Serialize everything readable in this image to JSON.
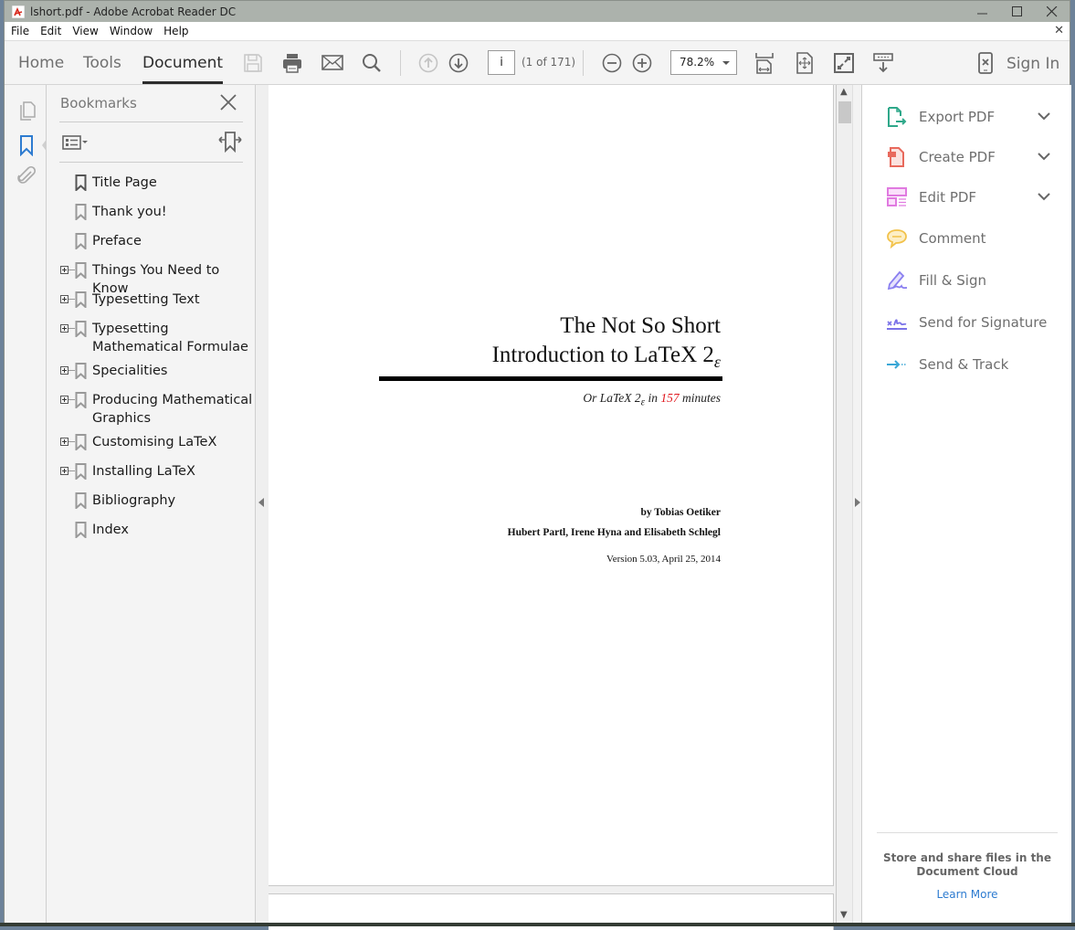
{
  "window": {
    "title": "lshort.pdf - Adobe Acrobat Reader DC",
    "controls": {
      "minimize": "minimize-icon",
      "maximize": "maximize-icon",
      "close": "close-icon"
    }
  },
  "menu": {
    "items": [
      "File",
      "Edit",
      "View",
      "Window",
      "Help"
    ],
    "close_doc_icon": "close-document-icon"
  },
  "toolbar": {
    "tabs": [
      {
        "label": "Home",
        "active": false
      },
      {
        "label": "Tools",
        "active": false
      },
      {
        "label": "Document",
        "active": true
      }
    ],
    "page_input": "i",
    "page_count": "(1 of 171)",
    "zoom_value": "78.2%",
    "sign_in": "Sign In",
    "icons": [
      "save-icon",
      "print-icon",
      "email-icon",
      "search-icon",
      "previous-page-icon",
      "next-page-icon",
      "zoom-out-icon",
      "zoom-in-icon",
      "fit-width-icon",
      "fit-page-icon",
      "full-screen-icon",
      "read-mode-icon",
      "mobile-link-icon"
    ]
  },
  "left_rail": {
    "icons": [
      "page-thumbnails-icon",
      "bookmarks-icon",
      "attachments-icon"
    ],
    "active": "bookmarks-icon",
    "accent": "#2d7bd0"
  },
  "bookmarks": {
    "header": "Bookmarks",
    "items": [
      {
        "label": "Title Page",
        "expandable": false
      },
      {
        "label": "Thank you!",
        "expandable": false
      },
      {
        "label": "Preface",
        "expandable": false
      },
      {
        "label": "Things You Need to Know",
        "expandable": true
      },
      {
        "label": "Typesetting Text",
        "expandable": true
      },
      {
        "label": "Typesetting Mathematical Formulae",
        "expandable": true
      },
      {
        "label": "Specialities",
        "expandable": true
      },
      {
        "label": "Producing Mathematical Graphics",
        "expandable": true
      },
      {
        "label": "Customising LaTeX",
        "expandable": true
      },
      {
        "label": "Installing LaTeX",
        "expandable": true
      },
      {
        "label": "Bibliography",
        "expandable": false
      },
      {
        "label": "Index",
        "expandable": false
      }
    ]
  },
  "document": {
    "title_line1": "The Not So Short",
    "title_line2_prefix": "Introduction to ",
    "latex_logo": "LaTeX",
    "latex_version": "2",
    "epsilon": "ε",
    "subtitle_prefix": "Or ",
    "subtitle_mid": " in ",
    "subtitle_number": "157",
    "subtitle_suffix": " minutes",
    "author_line": "by Tobias Oetiker",
    "coauthors_line": "Hubert Partl, Irene Hyna and Elisabeth Schlegl",
    "version_line": "Version 5.03, April 25, 2014",
    "highlight_color": "#e0161c"
  },
  "tools_pane": {
    "items": [
      {
        "label": "Export PDF",
        "icon": "export-pdf-icon",
        "color": "#2fa88a",
        "expandable": true
      },
      {
        "label": "Create PDF",
        "icon": "create-pdf-icon",
        "color": "#e8695c",
        "expandable": true
      },
      {
        "label": "Edit PDF",
        "icon": "edit-pdf-icon",
        "color": "#e07ae0",
        "expandable": true
      },
      {
        "label": "Comment",
        "icon": "comment-icon",
        "color": "#f2c24a",
        "expandable": false
      },
      {
        "label": "Fill & Sign",
        "icon": "fill-sign-icon",
        "color": "#8a7ff0",
        "expandable": false
      },
      {
        "label": "Send for Signature",
        "icon": "send-signature-icon",
        "color": "#7a72e8",
        "expandable": false
      },
      {
        "label": "Send & Track",
        "icon": "send-track-icon",
        "color": "#3aa7d6",
        "expandable": false
      }
    ],
    "cloud_message": "Store and share files in the Document Cloud",
    "learn_more": "Learn More"
  }
}
